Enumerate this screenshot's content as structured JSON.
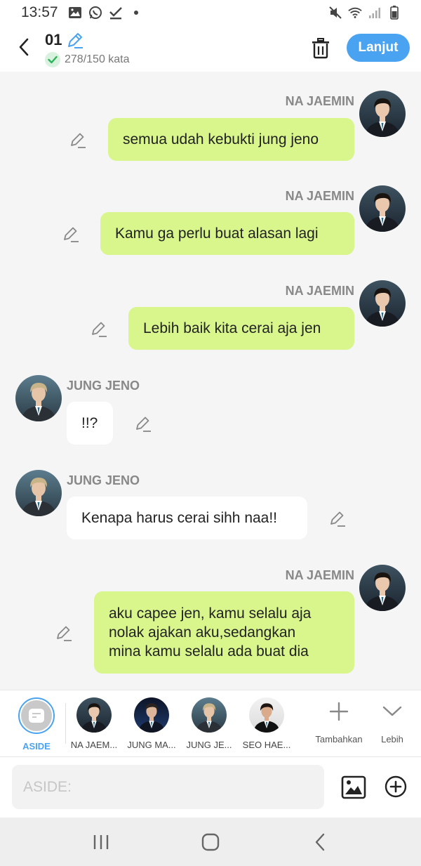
{
  "status_bar": {
    "time": "13:57"
  },
  "header": {
    "title": "01",
    "word_count": "278/150 kata",
    "next_label": "Lanjut"
  },
  "messages": [
    {
      "side": "right",
      "sender": "NA JAEMIN",
      "text": "semua udah kebukti jung jeno",
      "bubble": "green"
    },
    {
      "side": "right",
      "sender": "NA JAEMIN",
      "text": "Kamu ga perlu buat alasan lagi",
      "bubble": "green"
    },
    {
      "side": "right",
      "sender": "NA JAEMIN",
      "text": "Lebih baik kita cerai aja jen",
      "bubble": "green"
    },
    {
      "side": "left",
      "sender": "JUNG JENO",
      "text": "!!?",
      "bubble": "white"
    },
    {
      "side": "left",
      "sender": "JUNG JENO",
      "text": "Kenapa harus cerai sihh naa!!",
      "bubble": "white"
    },
    {
      "side": "right",
      "sender": "NA JAEMIN",
      "text": "aku capee jen, kamu selalu aja\nnolak ajakan aku,sedangkan\nmina kamu selalu ada buat dia",
      "bubble": "green"
    }
  ],
  "characters": [
    {
      "label": "ASIDE",
      "selected": true
    },
    {
      "label": "NA JAEM..."
    },
    {
      "label": "JUNG MA..."
    },
    {
      "label": "JUNG JE..."
    },
    {
      "label": "SEO HAE..."
    }
  ],
  "bar_actions": {
    "add_label": "Tambahkan",
    "more_label": "Lebih"
  },
  "input": {
    "placeholder": "ASIDE:",
    "value": ""
  },
  "colors": {
    "accent": "#4aa3f0",
    "my_bubble": "#d8f68c",
    "other_bubble": "#ffffff",
    "background": "#f5f5f5"
  }
}
